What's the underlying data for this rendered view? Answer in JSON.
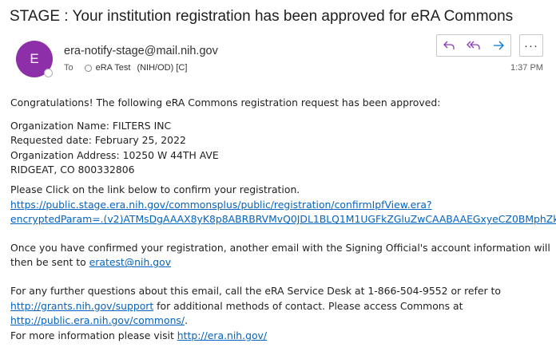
{
  "email": {
    "subject": "STAGE : Your institution registration has been approved for eRA Commons",
    "avatar_initial": "E",
    "sender": "era-notify-stage@mail.nih.gov",
    "to_label": "To",
    "recipient_name": "eRA Test",
    "recipient_org": "(NIH/OD) [C]",
    "time": "1:37 PM"
  },
  "actions": {
    "reply_icon": "reply-icon",
    "reply_all_icon": "reply-all-icon",
    "forward_icon": "forward-icon",
    "more_label": "···"
  },
  "body": {
    "congrats": "Congratulations! The following eRA Commons registration request has been approved:",
    "org_name": "Organization Name: FILTERS INC",
    "requested_date": "Requested date: February 25, 2022",
    "org_address": "Organization Address: 10250 W 44TH AVE",
    "city": "RIDGEAT, CO 800332806",
    "click_text": "Please Click on the link below to confirm your registration.",
    "confirm_link_line1": "https://public.stage.era.nih.gov/commonsplus/public/registration/confirmIpfView.era?",
    "confirm_link_line2": "encryptedParam=.(v2)ATMsDgAAAX8yK8p8ABRBRVMvQ0JDL1BLQ1M1UGFkZGluZwCAABAAEGxyeCZ0BMphZkH1",
    "confirmed_line1": "Once you have confirmed your registration, another email with the Signing Official's account information will",
    "confirmed_line2_prefix": "then be sent to ",
    "email_link": "eratest@nih.gov",
    "questions_line1": "For any further questions about this email, call the eRA Service Desk at 1-866-504-9552 or refer to",
    "support_link": "http://grants.nih.gov/support",
    "questions_line2_suffix": " for additional methods of contact. Please access Commons at",
    "commons_link": "http://public.era.nih.gov/commons/",
    "period": ".",
    "more_info_prefix": "For more information please visit ",
    "era_link": "http://era.nih.gov/"
  }
}
